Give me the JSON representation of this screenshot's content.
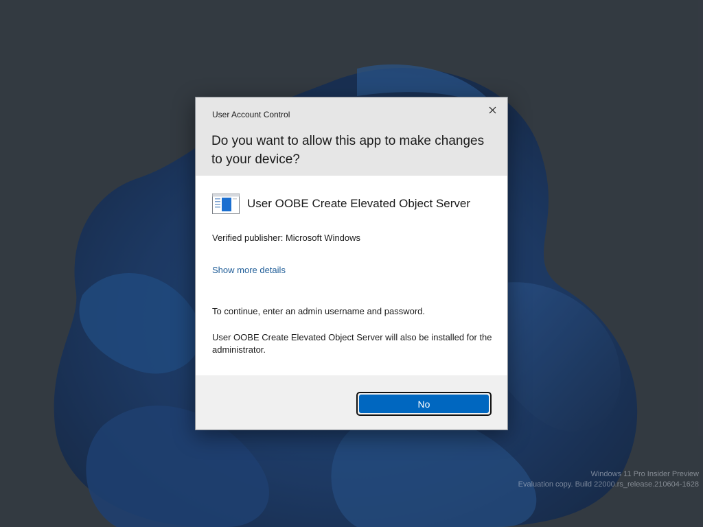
{
  "dialog": {
    "caption": "User Account Control",
    "question": "Do you want to allow this app to make changes to your device?",
    "app_name": "User OOBE Create Elevated Object Server",
    "app_icon": "application-window-icon",
    "publisher": "Verified publisher: Microsoft Windows",
    "details_link": "Show more details",
    "instruction": "To continue, enter an admin username and password.",
    "note": "User OOBE Create Elevated Object Server will also be installed for the administrator.",
    "no_label": "No",
    "close_icon": "close-icon"
  },
  "watermark": {
    "line1": "Windows 11 Pro Insider Preview",
    "line2": "Evaluation copy. Build 22000.rs_release.210604-1628"
  },
  "colors": {
    "accent": "#0067c0",
    "link": "#1e5c97",
    "header_bg": "#e6e6e6",
    "footer_bg": "#f0f0f0",
    "desktop_bg": "#3a4149"
  }
}
